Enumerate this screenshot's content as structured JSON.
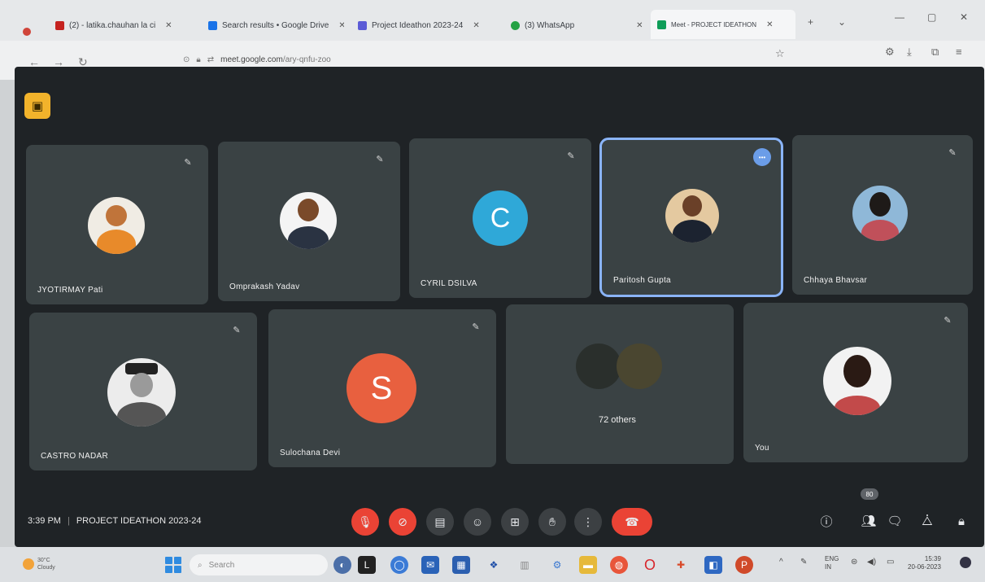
{
  "browser": {
    "tabs": [
      {
        "label": "(2) - latika.chauhan la ci",
        "color": "#c5221f"
      },
      {
        "label": "Search results • Google Drive",
        "color": "#1a73e8"
      },
      {
        "label": "Project Ideathon 2023-24",
        "color": "#5b5bd6"
      },
      {
        "label": "(3) WhatsApp",
        "color": "#25a244"
      },
      {
        "label": "Meet - PROJECT IDEATHON",
        "color": "#0f9d58"
      }
    ],
    "url_host": "meet.google.com",
    "url_path": "/ary-qnfu-zoo"
  },
  "meeting": {
    "time": "3:39 PM",
    "title": "PROJECT IDEATHON 2023-24",
    "participant_count": "80",
    "participants": [
      {
        "name": "JYOTIRMAY Pati",
        "avatar": "photo",
        "muted": true
      },
      {
        "name": "Omprakash Yadav",
        "avatar": "photo",
        "muted": true
      },
      {
        "name": "CYRIL DSILVA",
        "avatar": "letter",
        "letter": "C",
        "color": "#2fa8d8",
        "muted": true
      },
      {
        "name": "Paritosh Gupta",
        "avatar": "photo",
        "speaking": true
      },
      {
        "name": "Chhaya Bhavsar",
        "avatar": "photo",
        "muted": true
      },
      {
        "name": "CASTRO NADAR",
        "avatar": "photo",
        "muted": true
      },
      {
        "name": "Sulochana Devi",
        "avatar": "letter",
        "letter": "S",
        "color": "#e8603f",
        "muted": true
      },
      {
        "name": "72 others",
        "avatar": "others"
      },
      {
        "name": "You",
        "avatar": "photo",
        "muted": true
      }
    ]
  },
  "taskbar": {
    "weather_temp": "30°C",
    "weather_desc": "Cloudy",
    "search_placeholder": "Search",
    "lang": "ENG",
    "lang_region": "IN",
    "clock_time": "15:39",
    "clock_date": "20-06-2023"
  }
}
